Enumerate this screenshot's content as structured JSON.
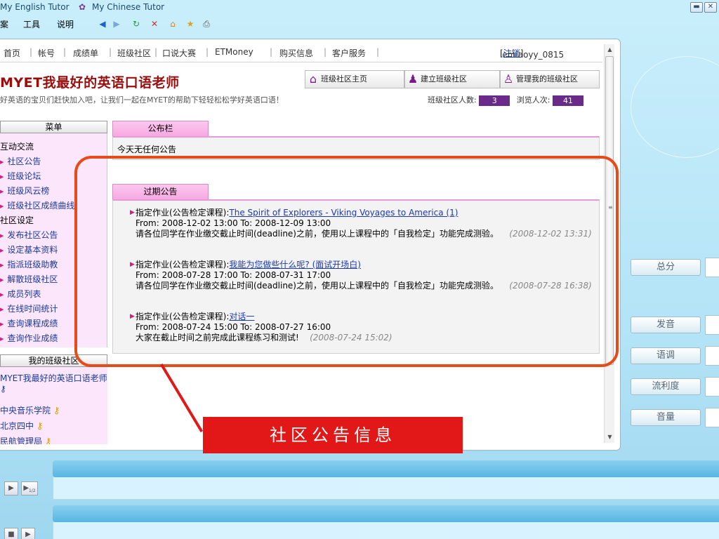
{
  "window": {
    "apps": [
      "My English Tutor",
      "My Chinese Tutor"
    ],
    "controls": [
      "minimize",
      "close"
    ]
  },
  "menubar": {
    "items": [
      "案",
      "工具",
      "说明"
    ]
  },
  "nav": {
    "items": [
      "首页",
      "帐号",
      "成绩单",
      "班级社区",
      "口说大赛",
      "ETMoney",
      "购买信息",
      "客户服务"
    ],
    "username": "lemiaoyy_0815",
    "logout": "注销"
  },
  "header": {
    "title": "MYET我最好的英语口语老师",
    "subtitle": "好英语的宝贝们赶快加入吧，让我们一起在MYET的帮助下轻轻松松学好英语口语！",
    "buttons": [
      "班级社区主页",
      "建立班级社区",
      "管理我的班级社区"
    ],
    "members_label": "班级社区人数:",
    "members_count": "3",
    "views_label": "浏览人次:",
    "views_count": "41"
  },
  "sidebar": {
    "menu_title": "菜单",
    "sections": [
      {
        "label": "互动交流",
        "items": [
          "社区公告",
          "班级论坛",
          "班级风云榜",
          "班级社区成绩曲线"
        ]
      },
      {
        "label": "社区设定",
        "items": [
          "发布社区公告",
          "设定基本资料",
          "指派班级助教",
          "解散班级社区",
          "成员列表",
          "在线时间统计",
          "查询课程成绩",
          "查询作业成绩"
        ]
      }
    ],
    "classes_title": "我的班级社区",
    "classes": [
      "MYET我最好的英语口语老师",
      "中央音乐学院",
      "北京四中",
      "民航管理局"
    ]
  },
  "bulletin": {
    "tab": "公布栏",
    "today": "今天无任何公告"
  },
  "past": {
    "tab": "过期公告",
    "items": [
      {
        "prefix": "指定作业(公告检定课程):",
        "link": "The Spirit of Explorers - Viking Voyages to America (1)",
        "dates": "From: 2008-12-02 13:00    To: 2008-12-09 13:00",
        "body": "请各位同学在作业缴交截止时间(deadline)之前，使用以上课程中的「自我检定」功能完成测验。",
        "posted": "(2008-12-02 13:31)"
      },
      {
        "prefix": "指定作业(公告检定课程):",
        "link": "我能为您做些什么呢? (面试开场白)",
        "dates": "From: 2008-07-28 17:00    To: 2008-07-31 17:00",
        "body": "请各位同学在作业缴交截止时间(deadline)之前，使用以上课程中的「自我检定」功能完成测验。",
        "posted": "(2008-07-28 16:38)"
      },
      {
        "prefix": "指定作业(公告检定课程):",
        "link": "对话一",
        "dates": "From: 2008-07-24 15:00    To: 2008-07-27 16:00",
        "body": "大家在截止时间之前完成此课程练习和测试!",
        "posted": "(2008-07-24 15:02)"
      }
    ]
  },
  "annotation": {
    "callout": "社区公告信息",
    "color": "#e21818"
  },
  "score_panel": {
    "labels": [
      "总分",
      "发音",
      "语调",
      "流利度",
      "音量"
    ]
  },
  "player": {
    "speed_label": "1/2"
  }
}
